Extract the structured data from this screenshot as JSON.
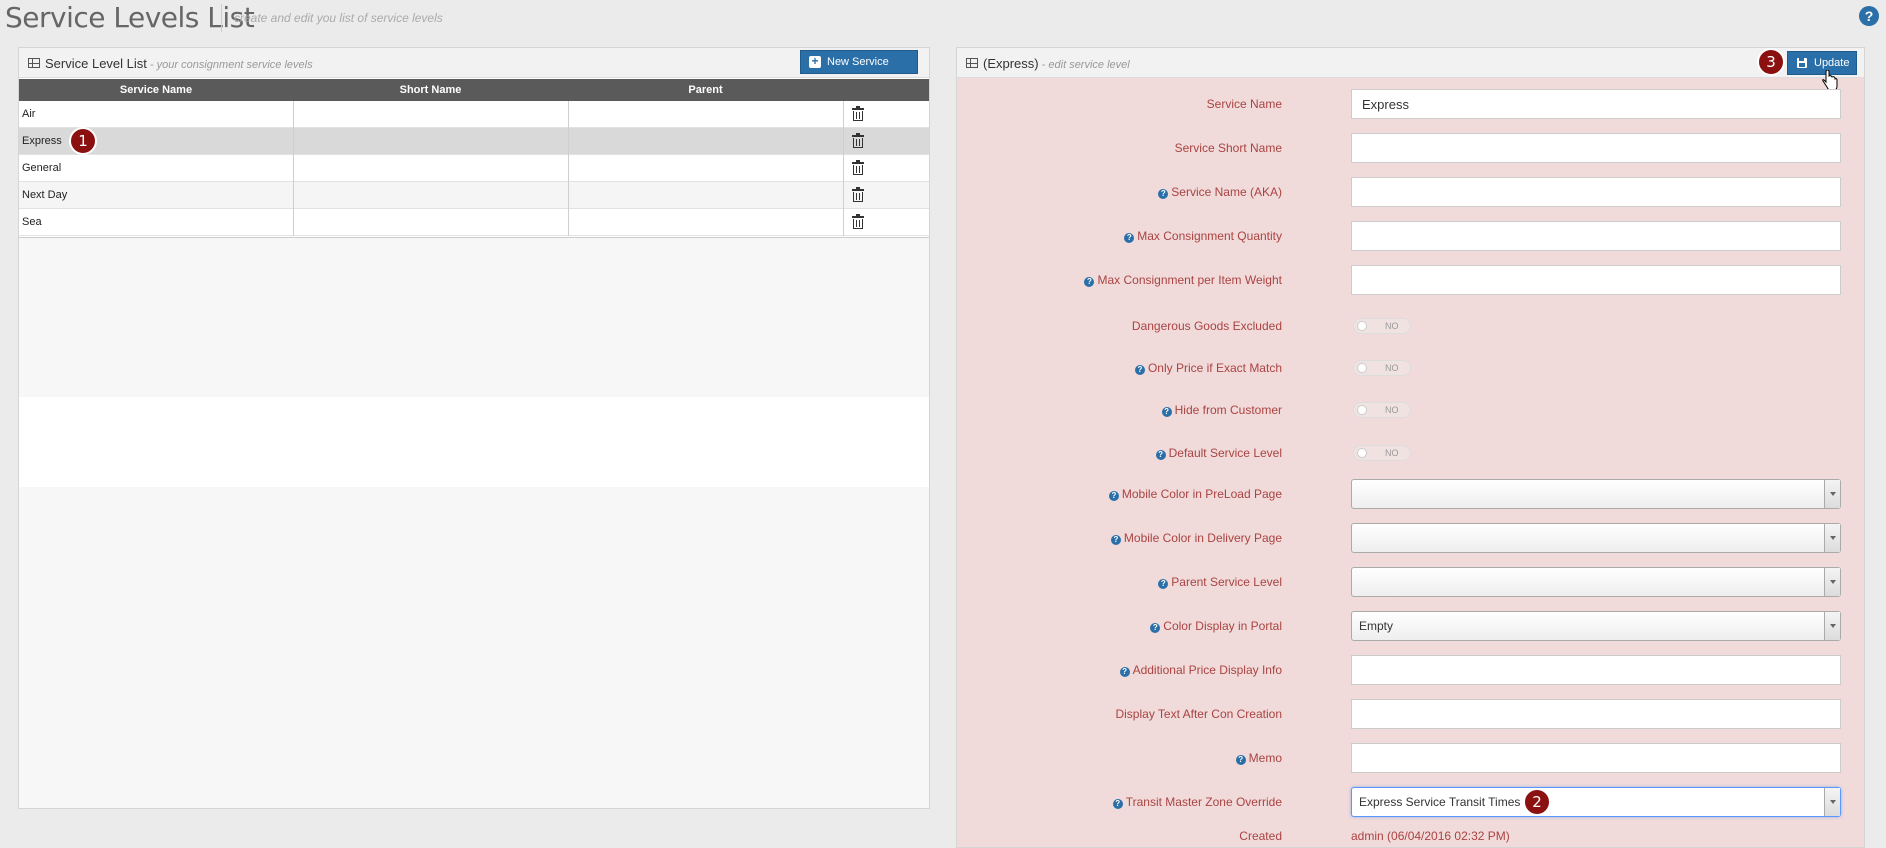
{
  "header": {
    "title": "Service Levels List",
    "subtitle": "create and edit you list of service levels",
    "help_glyph": "?"
  },
  "left_panel": {
    "title": "Service Level List",
    "subtitle": " - your consignment service levels",
    "new_button": "New Service Level",
    "columns": [
      "Service Name",
      "Short Name",
      "Parent"
    ],
    "rows": [
      {
        "name": "Air",
        "short": "",
        "parent": ""
      },
      {
        "name": "Express",
        "short": "",
        "parent": ""
      },
      {
        "name": "General",
        "short": "",
        "parent": ""
      },
      {
        "name": "Next Day",
        "short": "",
        "parent": ""
      },
      {
        "name": "Sea",
        "short": "",
        "parent": ""
      }
    ],
    "selected_row": "Express"
  },
  "right_panel": {
    "title": "(Express)",
    "subtitle": " - edit service level",
    "update_button": "Update",
    "fields": {
      "service_name": {
        "label": "Service Name",
        "value": "Express"
      },
      "short_name": {
        "label": "Service Short Name",
        "value": ""
      },
      "aka": {
        "label": "Service Name (AKA)",
        "value": ""
      },
      "max_qty": {
        "label": "Max Consignment Quantity",
        "value": ""
      },
      "max_weight": {
        "label": "Max Consignment per Item Weight",
        "value": ""
      },
      "dangerous": {
        "label": "Dangerous Goods Excluded",
        "value": "NO"
      },
      "exact_match": {
        "label": "Only Price if Exact Match",
        "value": "NO"
      },
      "hide_customer": {
        "label": "Hide from Customer",
        "value": "NO"
      },
      "default_level": {
        "label": "Default Service Level",
        "value": "NO"
      },
      "mobile_preload": {
        "label": "Mobile Color in PreLoad Page",
        "value": ""
      },
      "mobile_delivery": {
        "label": "Mobile Color in Delivery Page",
        "value": ""
      },
      "parent_level": {
        "label": "Parent Service Level",
        "value": ""
      },
      "color_portal": {
        "label": "Color Display in Portal",
        "value": "Empty"
      },
      "additional_price": {
        "label": "Additional Price Display Info",
        "value": ""
      },
      "display_text": {
        "label": "Display Text After Con Creation",
        "value": ""
      },
      "memo": {
        "label": "Memo",
        "value": ""
      },
      "transit_zone": {
        "label": "Transit Master Zone Override",
        "value": "Express Service Transit Times"
      },
      "created": {
        "label": "Created",
        "value": "admin (06/04/2016 02:32 PM)"
      }
    }
  },
  "badges": [
    "1",
    "2",
    "3"
  ],
  "colors": {
    "accent": "#2a6fa8",
    "form_bg": "#f1dada",
    "label_red": "#a94442",
    "badge": "#8b1010",
    "table_header": "#5a5a5a"
  },
  "icons": [
    "grid-icon",
    "plus-icon",
    "trash-icon",
    "save-icon",
    "help-icon",
    "cursor-hand-icon"
  ]
}
